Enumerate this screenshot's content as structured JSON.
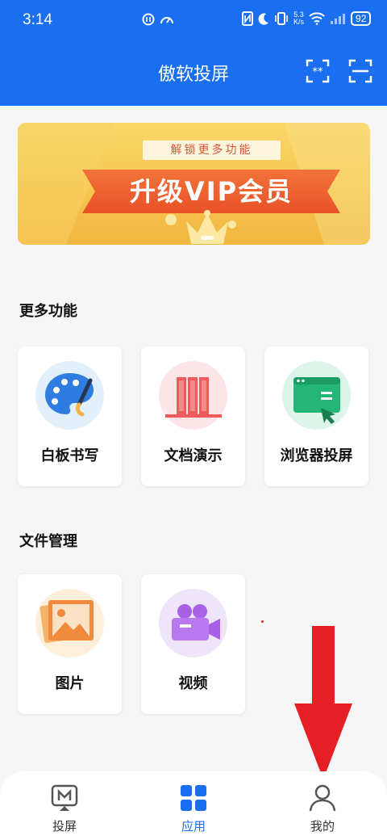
{
  "status_bar": {
    "time": "3:14",
    "network_speed_value": "5.3",
    "network_speed_unit": "K/s",
    "battery": "92"
  },
  "header": {
    "title": "傲软投屏",
    "icons": [
      "scan-code-icon",
      "scan-icon"
    ],
    "color": "#1a6ff0"
  },
  "banner": {
    "unlock_text": "解锁更多功能",
    "vip_text": "升级VIP会员"
  },
  "sections": {
    "more_features": {
      "title": "更多功能",
      "items": [
        {
          "label": "白板书写",
          "icon": "palette-icon"
        },
        {
          "label": "文档演示",
          "icon": "documents-icon"
        },
        {
          "label": "浏览器投屏",
          "icon": "browser-icon"
        }
      ]
    },
    "file_management": {
      "title": "文件管理",
      "items": [
        {
          "label": "图片",
          "icon": "picture-icon"
        },
        {
          "label": "视频",
          "icon": "video-camera-icon"
        }
      ]
    }
  },
  "tabbar": {
    "tabs": [
      {
        "label": "投屏",
        "icon": "cast-icon",
        "active": false
      },
      {
        "label": "应用",
        "icon": "apps-grid-icon",
        "active": true
      },
      {
        "label": "我的",
        "icon": "person-icon",
        "active": false
      }
    ]
  }
}
